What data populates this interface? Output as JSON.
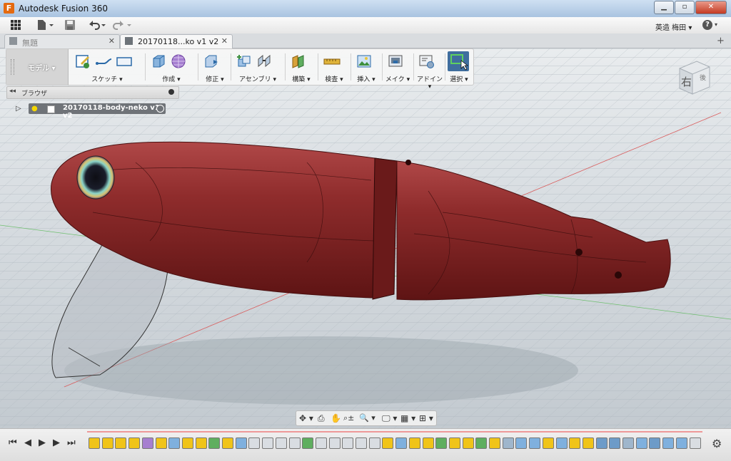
{
  "window": {
    "title": "Autodesk Fusion 360",
    "logo_letter": "F",
    "minimize": "▁",
    "maximize": "▫",
    "close": "✕"
  },
  "header": {
    "user_menu": "英造 梅田 ▾",
    "help": "?",
    "help_arrow": "▾"
  },
  "tabs": [
    {
      "label": "無題",
      "close": "✕",
      "active": false
    },
    {
      "label": "20170118...ko v1 v2",
      "close": "✕",
      "active": true
    }
  ],
  "tab_add": "+",
  "ribbon": {
    "workspace": "モデル ▾",
    "groups": [
      {
        "label": "スケッチ ▾",
        "icons": [
          "sketch-create-icon",
          "sketch-line-icon",
          "sketch-rectangle-icon"
        ]
      },
      {
        "label": "作成 ▾",
        "icons": [
          "extrude-box-icon",
          "form-sphere-icon"
        ]
      },
      {
        "label": "修正 ▾",
        "icons": [
          "press-pull-icon"
        ]
      },
      {
        "label": "アセンブリ ▾",
        "icons": [
          "new-component-icon",
          "joint-icon"
        ]
      },
      {
        "label": "構築 ▾",
        "icons": [
          "offset-plane-icon"
        ]
      },
      {
        "label": "検査 ▾",
        "icons": [
          "measure-icon"
        ]
      },
      {
        "label": "挿入 ▾",
        "icons": [
          "insert-image-icon"
        ]
      },
      {
        "label": "メイク ▾",
        "icons": [
          "3d-print-icon"
        ]
      },
      {
        "label": "アドイン ▾",
        "icons": [
          "scripts-icon"
        ]
      },
      {
        "label": "選択 ▾",
        "icons": [
          "select-window-icon"
        ]
      }
    ]
  },
  "browser": {
    "collapse": "◂◂",
    "label": "ブラウザ",
    "root_item": "20170118-body-neko v1 v2",
    "expand": "▷",
    "bulb": "💡"
  },
  "viewcube": {
    "face_label": "右",
    "side_label": "後"
  },
  "navbar": {
    "items": [
      "✥ ▾",
      "⎙",
      "✋",
      "⌕±",
      "🔍 ▾",
      "🖵 ▾",
      "▦ ▾",
      "⊞ ▾"
    ]
  },
  "timeline": {
    "controls": [
      "⏮",
      "◀",
      "▶",
      "▶",
      "⏭"
    ],
    "features": [
      "sketch",
      "sketch",
      "sketch",
      "sketch",
      "form",
      "sketch",
      "extrude",
      "sketch",
      "sketch",
      "loft",
      "sketch",
      "extrude",
      "move",
      "move",
      "move",
      "move",
      "loft",
      "move",
      "move",
      "move",
      "move",
      "move",
      "sketch",
      "extrude",
      "sketch",
      "sketch",
      "loft",
      "sketch",
      "sketch",
      "split",
      "sketch",
      "hole",
      "extrude",
      "extrude",
      "sketch",
      "extrude",
      "sketch",
      "sketch",
      "combine",
      "combine",
      "hole",
      "extrude",
      "combine",
      "extrude",
      "extrude",
      "move"
    ],
    "settings": "⚙"
  },
  "colors": {
    "body": "#8a2a2a",
    "accent": "#2b6aa8",
    "grid_line": "#aab3bb",
    "axis_red": "#d95c5c",
    "axis_green": "#6fbf6f"
  }
}
